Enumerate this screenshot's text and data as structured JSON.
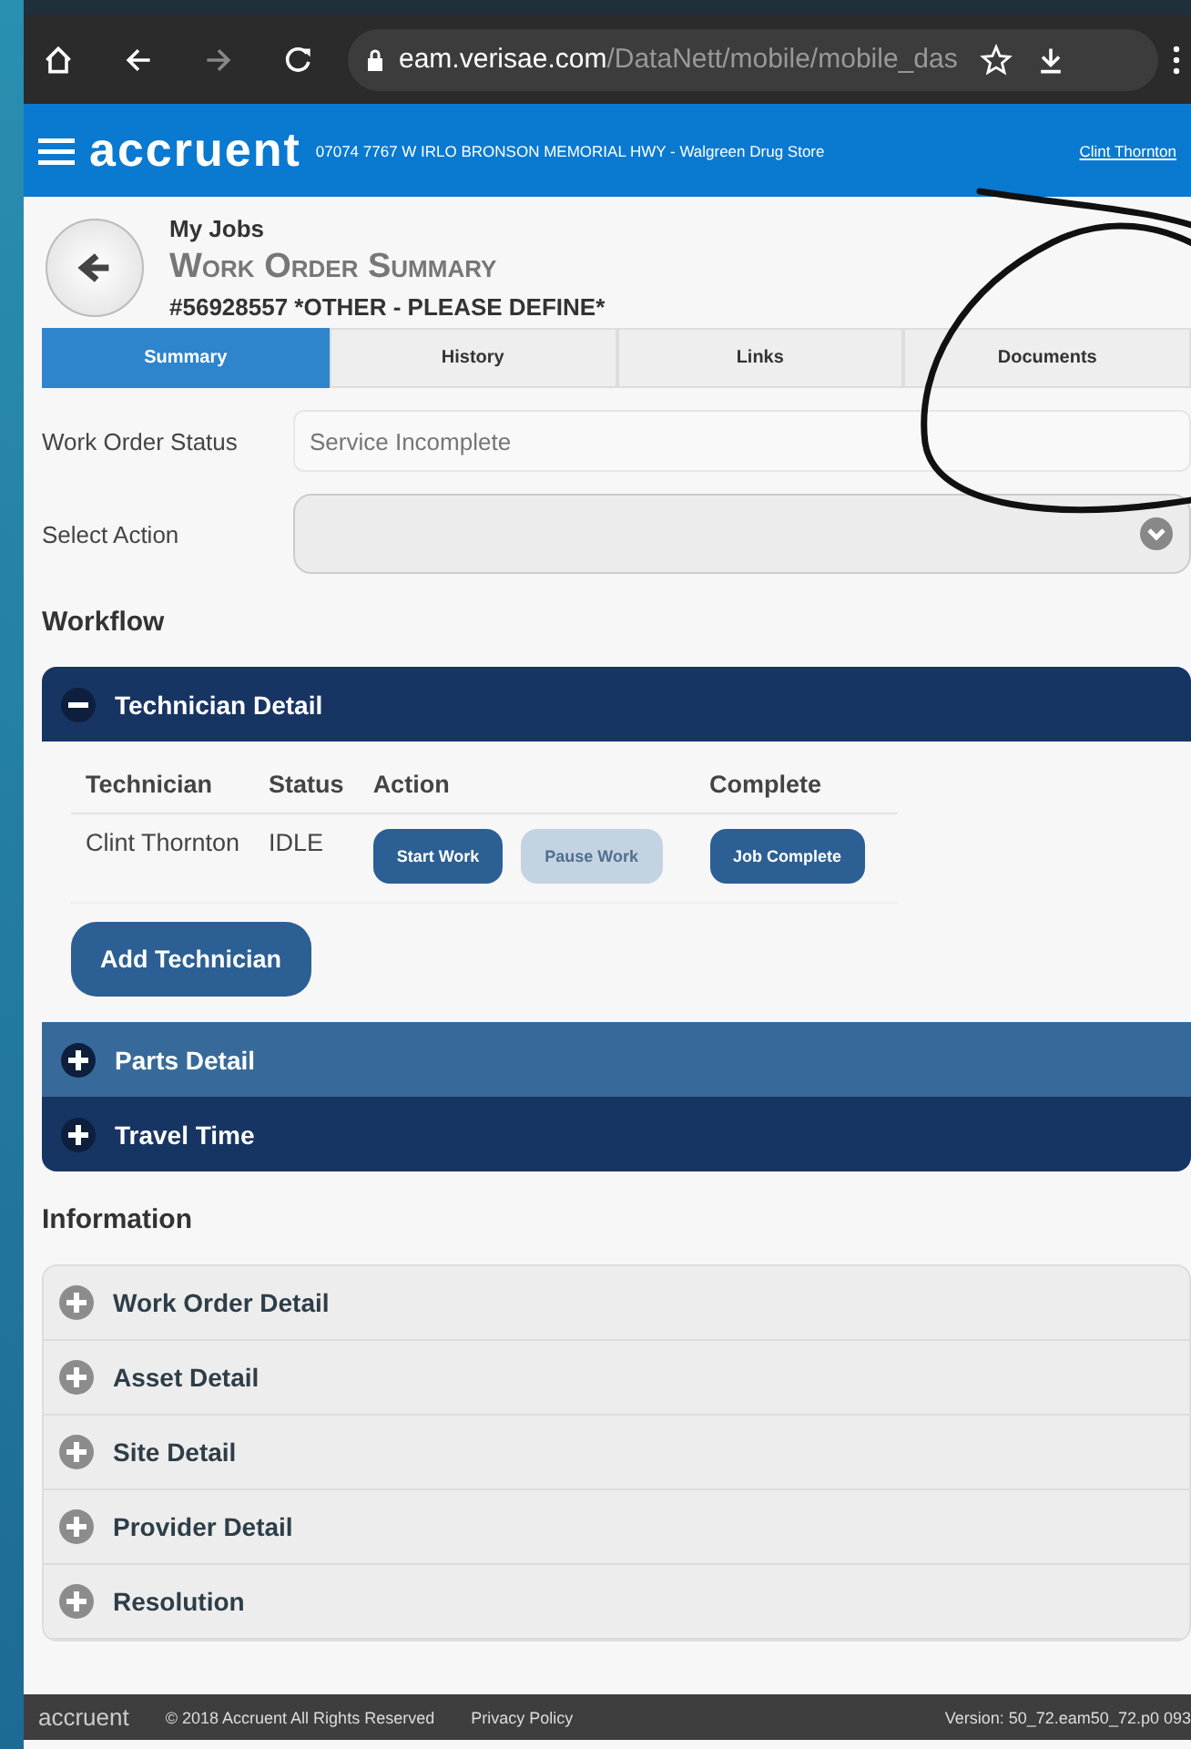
{
  "browser": {
    "url_host": "eam.verisae.com",
    "url_path": "/DataNett/mobile/mobile_das"
  },
  "header": {
    "logo": "accruent",
    "location": "07074 7767 W IRLO BRONSON MEMORIAL HWY - Walgreen Drug Store",
    "user": "Clint Thornton"
  },
  "page": {
    "breadcrumb": "My Jobs",
    "title": "Work Order Summary",
    "subtitle": "#56928557 *OTHER - PLEASE DEFINE*"
  },
  "tabs": [
    {
      "label": "Summary",
      "selected": true
    },
    {
      "label": "History",
      "selected": false
    },
    {
      "label": "Links",
      "selected": false
    },
    {
      "label": "Documents",
      "selected": false
    }
  ],
  "fields": [
    {
      "label": "Work Order Status",
      "kind": "text",
      "placeholder": "Service Incomplete"
    },
    {
      "label": "Select Action",
      "kind": "select"
    }
  ],
  "workflow": {
    "heading": "Workflow",
    "panels": [
      {
        "title": "Technician Detail",
        "expanded": true,
        "columns": [
          "Technician",
          "Status",
          "Action",
          "Complete"
        ],
        "rows": [
          {
            "technician": "Clint Thornton",
            "status": "IDLE",
            "actions": [
              {
                "label": "Start Work",
                "disabled": false
              },
              {
                "label": "Pause Work",
                "disabled": true
              }
            ],
            "complete": {
              "label": "Job Complete",
              "disabled": false
            }
          }
        ],
        "add_button": "Add Technician"
      },
      {
        "title": "Parts Detail",
        "expanded": false
      },
      {
        "title": "Travel Time",
        "expanded": false
      }
    ]
  },
  "information": {
    "heading": "Information",
    "items": [
      {
        "title": "Work Order Detail"
      },
      {
        "title": "Asset Detail"
      },
      {
        "title": "Site Detail"
      },
      {
        "title": "Provider Detail"
      },
      {
        "title": "Resolution"
      }
    ]
  },
  "footer": {
    "logo": "accruent",
    "copyright": "© 2018 Accruent All Rights Reserved",
    "privacy": "Privacy Policy",
    "version": "Version: 50_72.eam50_72.p0  093"
  }
}
